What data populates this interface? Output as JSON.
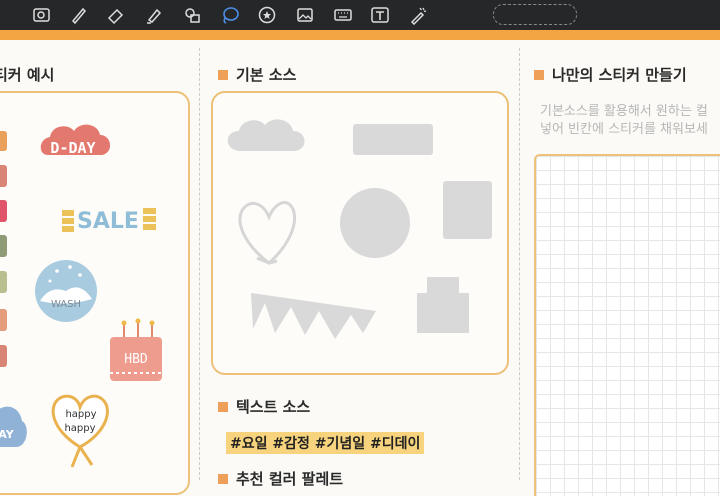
{
  "toolbar": {
    "icons": [
      "gallery-icon",
      "pen-icon",
      "eraser-icon",
      "highlighter-icon",
      "shapes-icon",
      "lasso-icon",
      "sticker-icon",
      "image-icon",
      "keyboard-icon",
      "text-icon",
      "laser-pointer-icon"
    ]
  },
  "sections": {
    "example": {
      "title": "티커 예시"
    },
    "basic": {
      "title": "기본 소스"
    },
    "text": {
      "title": "텍스트 소스"
    },
    "palette": {
      "title": "추천 컬러 팔레트"
    },
    "custom": {
      "title": "나만의 스티커 만들기",
      "desc_line1": "기본소스를 활용해서 원하는 컬",
      "desc_line2": "넣어 빈칸에 스티커를 채워보세"
    }
  },
  "stickers": {
    "dday": "D-DAY",
    "sale": "SALE",
    "wash": "WASH",
    "hbd": "HBD",
    "happy1": "happy",
    "happy2": "happy",
    "partial": "AY"
  },
  "text_tags": "#요일 #감정 #기념일 #디데이",
  "colors": {
    "accent": "#f3a544",
    "panel_border": "#edc17a",
    "bullet": "#ee9f58",
    "tag_highlight": "#f6d37c"
  }
}
